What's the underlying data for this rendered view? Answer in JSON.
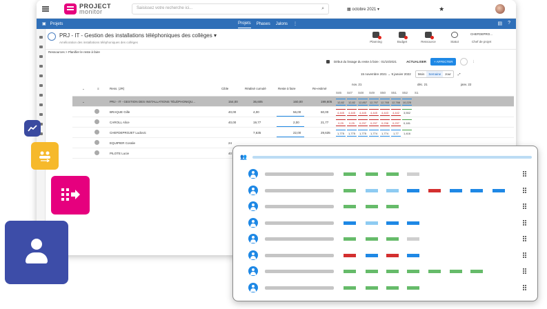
{
  "app": {
    "logo_line1": "PROJECT",
    "logo_line2": "monitor",
    "search_placeholder": "Saisissez votre recherche ici...",
    "month": "octobre 2021",
    "nav_label": "Projets",
    "tabs": [
      "Projets",
      "Phases",
      "Jalons"
    ]
  },
  "project": {
    "title": "PRJ - IT - Gestion des installations téléphoniques des collèges",
    "subtitle": "Amélioration des installations téléphoniques des collèges",
    "actions": [
      "Planning",
      "Budget",
      "Ressource",
      "Statut"
    ],
    "chef_name": "CHEFDEPRO...",
    "chef_label": "Chef de projet"
  },
  "breadcrumb": "Ressources > Planifier le reste à faire",
  "toolbar": {
    "freeze": "Début du lissage du reste à faire : 01/10/2021",
    "actualiser": "ACTUALISER",
    "affecter": "+ AFFECTER"
  },
  "range": {
    "dates": "15 novembre 2021 → 9 janvier 2022",
    "views": [
      "Mois",
      "Semaine",
      "Jour"
    ],
    "selected": "Semaine"
  },
  "grid": {
    "headers": [
      "Ress. (JR)",
      "Cible",
      "Réalisé cumulé",
      "Reste à faire",
      "Re-estimé"
    ],
    "periods": [
      "nov. 21",
      "déc. 21",
      "janv. 22"
    ],
    "weeks": [
      "S46",
      "S47",
      "S48",
      "S49",
      "S50",
      "S51",
      "S52",
      "S1"
    ],
    "rows": [
      {
        "name": "PRJ - IT - GESTION DES INSTALLATIONS TÉLÉPHONIQU...",
        "sub": "01/07/2021 - 31/12/2021",
        "cible": "154,00",
        "realise": "36,605",
        "raf": "160,00",
        "reest": "199,605",
        "weeks": [
          "12,82",
          "12,82",
          "12,857",
          "12,797",
          "12,765",
          "12,766",
          "10,225",
          ""
        ],
        "style": [
          "blue",
          "blue",
          "blue",
          "blue",
          "blue",
          "blue",
          "blue",
          ""
        ]
      },
      {
        "name": "BRAQUE Gille",
        "sub": "",
        "cible": "40,00",
        "realise": "4,00",
        "raf": "56,00",
        "reest": "60,00",
        "weeks": [
          "4,445",
          "4,445",
          "4,445",
          "4,445",
          "4,443",
          "4,442",
          "3,552",
          ""
        ],
        "style": [
          "red",
          "red",
          "red",
          "red",
          "red",
          "red",
          "green",
          ""
        ]
      },
      {
        "name": "CAROLL Alice",
        "sub": "",
        "cible": "40,00",
        "realise": "19,77",
        "raf": "2,00",
        "reest": "21,77",
        "weeks": [
          "0,25",
          "0,25",
          "0,237",
          "0,237",
          "0,238",
          "0,237",
          "0,181",
          ""
        ],
        "style": [
          "red",
          "red",
          "red",
          "red",
          "red",
          "red",
          "green",
          ""
        ]
      },
      {
        "name": "CHEFDEPROJET Ludovic",
        "sub": "",
        "cible": "",
        "realise": "7,635",
        "raf": "22,00",
        "reest": "29,635",
        "weeks": [
          "1,775",
          "1,775",
          "1,775",
          "1,774",
          "1,774",
          "1,77",
          "1,416",
          ""
        ],
        "style": [
          "blue",
          "blue",
          "blue",
          "blue",
          "blue",
          "blue",
          "green",
          ""
        ]
      },
      {
        "name": "EQUIPIER Coralie",
        "sub": "",
        "cible": "24",
        "realise": "",
        "raf": "",
        "reest": "",
        "weeks": [],
        "style": []
      },
      {
        "name": "PILOTE Lucie",
        "sub": "",
        "cible": "40",
        "realise": "",
        "raf": "",
        "reest": "",
        "weeks": [],
        "style": []
      }
    ]
  },
  "card": {
    "colors": {
      "green": "#66bb6a",
      "light_blue": "#8ecbf2",
      "blue": "#1e88e5",
      "red": "#d32f2f",
      "grey": "#cfcfcf"
    },
    "rows": [
      [
        "green",
        "green",
        "green",
        "grey",
        "",
        "",
        "",
        "",
        ""
      ],
      [
        "green",
        "light_blue",
        "light_blue",
        "blue",
        "red",
        "blue",
        "blue",
        "blue",
        ""
      ],
      [
        "green",
        "green",
        "green",
        "",
        "",
        "",
        "",
        "",
        ""
      ],
      [
        "blue",
        "light_blue",
        "blue",
        "blue",
        "",
        "",
        "",
        "",
        ""
      ],
      [
        "green",
        "green",
        "green",
        "grey",
        "",
        "",
        "",
        "",
        ""
      ],
      [
        "red",
        "blue",
        "red",
        "blue",
        "",
        "",
        "",
        "",
        ""
      ],
      [
        "green",
        "green",
        "green",
        "green",
        "green",
        "green",
        "green",
        "",
        ""
      ],
      [
        "green",
        "green",
        "green",
        "green",
        "",
        "",
        "",
        "",
        ""
      ]
    ]
  }
}
